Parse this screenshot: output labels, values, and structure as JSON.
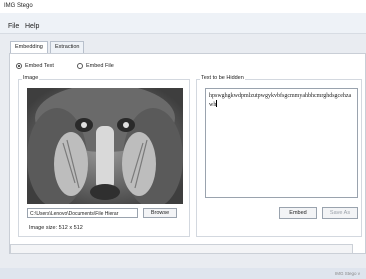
{
  "window": {
    "title": "IMG Stego"
  },
  "menu": {
    "items": [
      "File",
      "Help"
    ]
  },
  "tabs": [
    {
      "label": "Embedding",
      "active": true
    },
    {
      "label": "Extraction",
      "active": false
    }
  ],
  "mode": {
    "embed_text": {
      "label": "Embed Text",
      "checked": true
    },
    "embed_file": {
      "label": "Embed File",
      "checked": false
    }
  },
  "image_group": {
    "label": "Image",
    "path_value": "C:\\Users\\Lenovo\\Documents\\File Hierar",
    "browse_label": "Browse",
    "size_text": "Image size: 512 x 512"
  },
  "text_group": {
    "label": "Text to be Hidden",
    "content": "hpswghgkwdpmlzutpwgykvbfsgcmmyahbhcmrghdsgcehzawh",
    "embed_label": "Embed",
    "save_label": "Save As"
  },
  "statusbar": {
    "text": "IMG Stego v"
  }
}
